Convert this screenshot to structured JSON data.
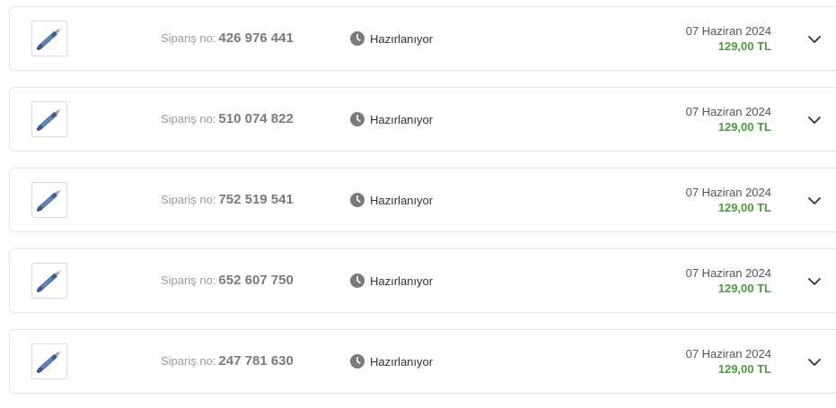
{
  "orders": [
    {
      "order_label": "Sipariş no:",
      "order_number": "426 976 441",
      "status": "Hazırlanıyor",
      "date": "07 Haziran 2024",
      "price": "129,00 TL"
    },
    {
      "order_label": "Sipariş no:",
      "order_number": "510 074 822",
      "status": "Hazırlanıyor",
      "date": "07 Haziran 2024",
      "price": "129,00 TL"
    },
    {
      "order_label": "Sipariş no:",
      "order_number": "752 519 541",
      "status": "Hazırlanıyor",
      "date": "07 Haziran 2024",
      "price": "129,00 TL"
    },
    {
      "order_label": "Sipariş no:",
      "order_number": "652 607 750",
      "status": "Hazırlanıyor",
      "date": "07 Haziran 2024",
      "price": "129,00 TL"
    },
    {
      "order_label": "Sipariş no:",
      "order_number": "247 781 630",
      "status": "Hazırlanıyor",
      "date": "07 Haziran 2024",
      "price": "129,00 TL"
    }
  ],
  "icons": {
    "status": "clock-icon",
    "expand": "chevron-down-icon",
    "product": "product-thumbnail"
  },
  "colors": {
    "price": "#4a9d3a",
    "status_icon": "#7a7a7a",
    "order_number": "#7a7a7a"
  }
}
